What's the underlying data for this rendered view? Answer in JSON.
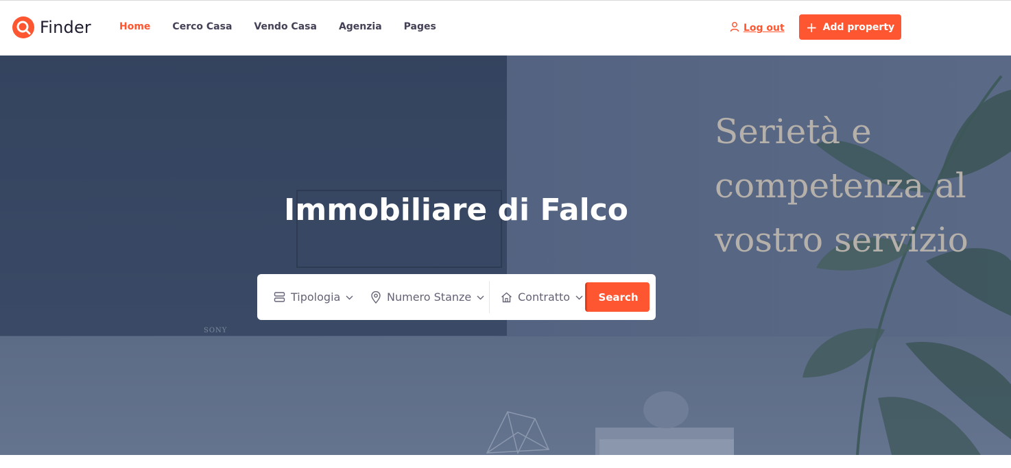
{
  "header": {
    "logo_text": "Finder",
    "nav": [
      {
        "label": "Home",
        "active": true
      },
      {
        "label": "Cerco Casa",
        "active": false
      },
      {
        "label": "Vendo Casa",
        "active": false
      },
      {
        "label": "Agenzia",
        "active": false
      },
      {
        "label": "Pages",
        "active": false
      }
    ],
    "logout_label": "Log out",
    "add_property_label": "Add property"
  },
  "hero": {
    "title": "Immobiliare di Falco",
    "tagline": "Serietà e competenza al vostro servizio",
    "tv_brand": "SONY"
  },
  "search": {
    "tipologia_label": "Tipologia",
    "stanze_label": "Numero Stanze",
    "contratto_label": "Contratto",
    "button_label": "Search"
  },
  "colors": {
    "accent": "#fd5631",
    "nav_text": "#454056",
    "hero_overlay": "#56657f"
  }
}
